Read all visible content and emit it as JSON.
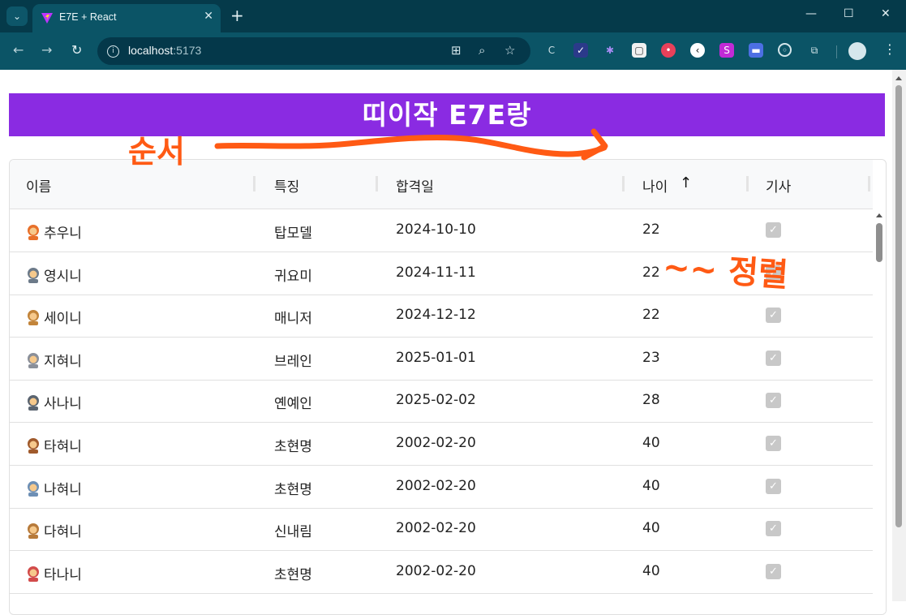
{
  "browser": {
    "tab_title": "E7E + React",
    "tab_close": "✕",
    "new_tab": "+",
    "url_host": "localhost",
    "url_port": ":5173",
    "window_controls": [
      "—",
      "☐",
      "✕"
    ]
  },
  "page": {
    "banner_title": "띠이작 E7E랑"
  },
  "table": {
    "columns": [
      "이름",
      "특징",
      "합격일",
      "나이",
      "기사"
    ],
    "sort_indicator": "↑",
    "rows": [
      {
        "name": "추우니",
        "trait": "탑모델",
        "date": "2024-10-10",
        "age": "22",
        "checked": true,
        "emoji": "woman-red"
      },
      {
        "name": "영시니",
        "trait": "귀요미",
        "date": "2024-11-11",
        "age": "22",
        "checked": true,
        "emoji": "person-laptop"
      },
      {
        "name": "세이니",
        "trait": "매니저",
        "date": "2024-12-12",
        "age": "22",
        "checked": true,
        "emoji": "woman"
      },
      {
        "name": "지혀니",
        "trait": "브레인",
        "date": "2025-01-01",
        "age": "23",
        "checked": true,
        "emoji": "scientist"
      },
      {
        "name": "사나니",
        "trait": "옌예인",
        "date": "2025-02-02",
        "age": "28",
        "checked": true,
        "emoji": "detective"
      },
      {
        "name": "타혀니",
        "trait": "초현명",
        "date": "2002-02-20",
        "age": "40",
        "checked": true,
        "emoji": "woman-office"
      },
      {
        "name": "나혀니",
        "trait": "초현명",
        "date": "2002-02-20",
        "age": "40",
        "checked": true,
        "emoji": "woman-office-2"
      },
      {
        "name": "다혀니",
        "trait": "신내림",
        "date": "2002-02-20",
        "age": "40",
        "checked": true,
        "emoji": "woman-2"
      },
      {
        "name": "타나니",
        "trait": "초현명",
        "date": "2002-02-20",
        "age": "40",
        "checked": true,
        "emoji": "cook"
      }
    ]
  },
  "annotations": {
    "left_text": "순서",
    "right_text": "~~ 정렬"
  },
  "colors": {
    "banner": "#8a2be2",
    "ink": "#ff5a14",
    "chrome": "#0b5466"
  }
}
